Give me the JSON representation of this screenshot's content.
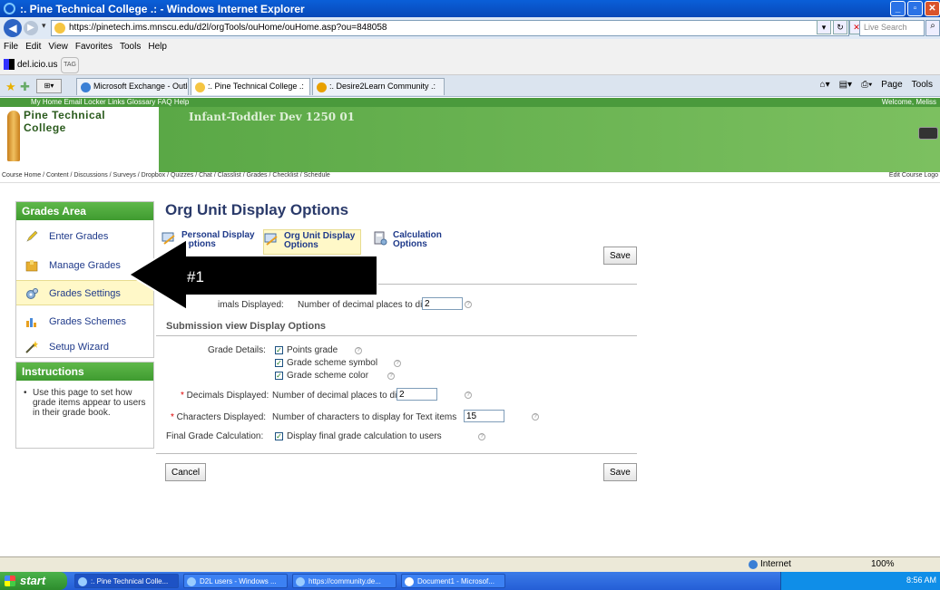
{
  "browser": {
    "window_title": ":. Pine Technical College .: - Windows Internet Explorer",
    "url": "https://pinetech.ims.mnscu.edu/d2l/orgTools/ouHome/ouHome.asp?ou=848058",
    "search_placeholder": "Live Search",
    "menu": [
      "File",
      "Edit",
      "View",
      "Favorites",
      "Tools",
      "Help"
    ],
    "links_bar": {
      "delicious": "del.icio.us",
      "tag": "TAG"
    },
    "tabs": [
      {
        "label": "Microsoft Exchange - Outloo...",
        "active": false
      },
      {
        "label": ":. Pine Technical College .:",
        "active": true
      },
      {
        "label": ":. Desire2Learn Community .:",
        "active": false
      }
    ],
    "commands": [
      "Page",
      "Tools"
    ],
    "status": {
      "zone": "Internet",
      "zoom": "100%"
    }
  },
  "d2l": {
    "top_links": "My Home  Email  Locker  Links  Glossary  FAQ  Help",
    "welcome": "Welcome, Meliss",
    "logo_line1": "Pine Technical",
    "logo_line2": "College",
    "course_title": "Infant-Toddler Dev 1250 01",
    "breadcrumb": "Course Home / Content / Discussions / Surveys / Dropbox / Quizzes / Chat / Classlist / Grades / Checklist / Schedule",
    "edit_course": "Edit Course  Logo"
  },
  "leftnav": {
    "header": "Grades Area",
    "items": [
      {
        "label": "Enter Grades",
        "icon": "pencil-icon"
      },
      {
        "label": "Manage Grades",
        "icon": "folder-icon"
      },
      {
        "label": "Grades Settings",
        "icon": "gear-icon"
      },
      {
        "label": "Grades Schemes",
        "icon": "chart-icon"
      },
      {
        "label": "Setup Wizard",
        "icon": "wand-icon"
      }
    ],
    "selected": "Grades Settings"
  },
  "instructions": {
    "header": "Instructions",
    "text": "Use this page to set how grade items appear to users in their grade book."
  },
  "main": {
    "title": "Org Unit Display Options",
    "subtabs": [
      {
        "label": "Personal Display Options",
        "active": false
      },
      {
        "label": "Org Unit Display Options",
        "active": true
      },
      {
        "label": "Calculation Options",
        "active": false
      }
    ],
    "save_label": "Save",
    "cancel_label": "Cancel",
    "partial_decimals_label": "imals Displayed:",
    "decimals_desc": "Number of decimal places to display",
    "decimals_value_1": "2",
    "section_submission": "Submission view Display Options",
    "grade_details_label": "Grade Details:",
    "grade_details_options": [
      "Points grade",
      "Grade scheme symbol",
      "Grade scheme color"
    ],
    "decimals_label": "Decimals Displayed:",
    "decimals_value_2": "2",
    "characters_label": "Characters Displayed:",
    "characters_desc": "Number of characters to display for Text items",
    "characters_value": "15",
    "final_grade_label": "Final Grade Calculation:",
    "final_grade_option": "Display final grade calculation to users"
  },
  "annotation": {
    "text": "#1"
  },
  "taskbar": {
    "start": "start",
    "tasks": [
      ":. Pine Technical Colle...",
      "D2L users - Windows ...",
      "https://community.de...",
      "Document1 - Microsof..."
    ],
    "clock": "8:56 AM"
  }
}
